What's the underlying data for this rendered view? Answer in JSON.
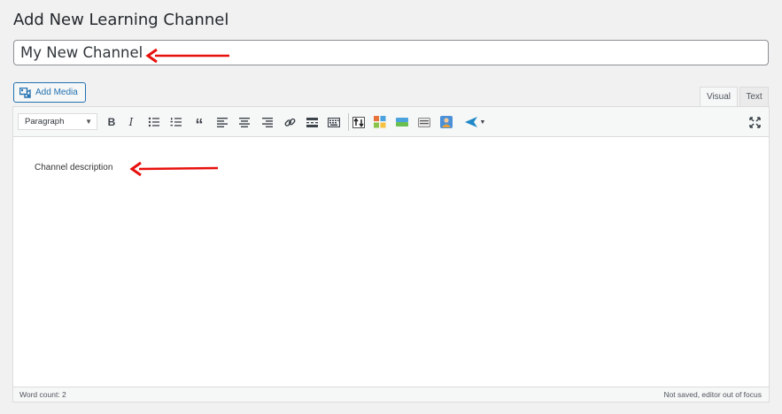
{
  "page": {
    "title": "Add New Learning Channel"
  },
  "title_field": {
    "value": "My New Channel"
  },
  "media": {
    "add_media_label": "Add Media"
  },
  "editor_tabs": {
    "visual": "Visual",
    "text": "Text"
  },
  "toolbar": {
    "format_value": "Paragraph",
    "buttons": [
      {
        "name": "bold",
        "glyph": "B"
      },
      {
        "name": "italic",
        "glyph": "I"
      },
      {
        "name": "bulleted-list"
      },
      {
        "name": "numbered-list"
      },
      {
        "name": "blockquote",
        "glyph": "“"
      },
      {
        "name": "align-left"
      },
      {
        "name": "align-center"
      },
      {
        "name": "align-right"
      },
      {
        "name": "insert-link"
      },
      {
        "name": "read-more"
      },
      {
        "name": "toolbar-toggle"
      },
      {
        "name": "upload"
      },
      {
        "name": "plugin-blocks"
      },
      {
        "name": "plugin-button"
      },
      {
        "name": "plugin-divider"
      },
      {
        "name": "plugin-user"
      },
      {
        "name": "plugin-send"
      },
      {
        "name": "fullscreen"
      }
    ]
  },
  "content": {
    "text": "Channel description"
  },
  "status": {
    "word_count": "Word count: 2",
    "save_status": "Not saved, editor out of focus"
  },
  "colors": {
    "accent": "#2271b1",
    "arrow": "#e8100c",
    "border": "#dcdcde",
    "background": "#f1f1f1"
  }
}
